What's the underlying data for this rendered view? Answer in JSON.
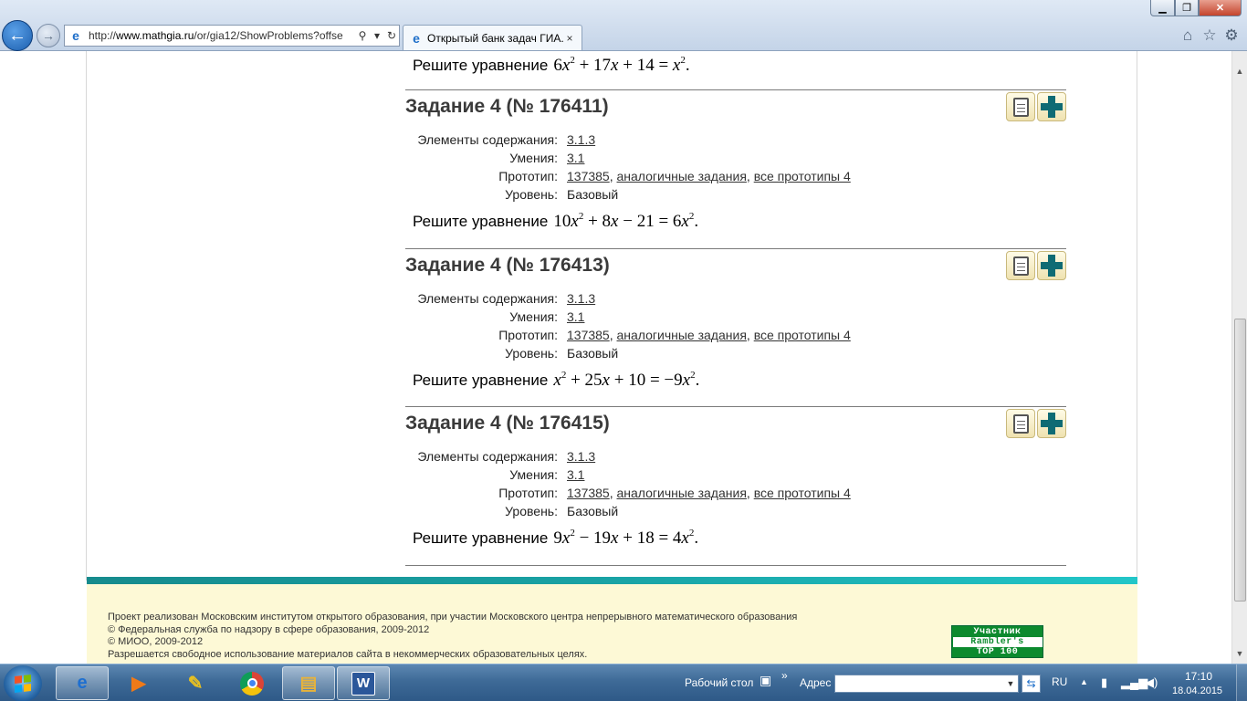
{
  "browser": {
    "address_url_prefix": "http://",
    "address_url_domain": "www.mathgia.ru",
    "address_url_path": "/or/gia12/ShowProblems?offse",
    "tab_title": "Открытый банк задач ГИА...",
    "tab_close": "×",
    "back_glyph": "←",
    "forward_glyph": "→",
    "search_glyph": "⚲",
    "dropdown_glyph": "▾",
    "refresh_glyph": "↻",
    "minimize_glyph": "▁",
    "maximize_glyph": "❐",
    "close_glyph": "✕",
    "home_glyph": "⌂",
    "favorites_glyph": "☆",
    "tools_glyph": "⚙"
  },
  "page": {
    "partial_prompt": "Решите уравнение",
    "tasks": [
      {
        "title": "Задание 4 (№ 176411)",
        "labels": {
          "content": "Элементы содержания:",
          "skills": "Умения:",
          "prototype": "Прототип:",
          "level": "Уровень:"
        },
        "content_code": "3.1.3",
        "skill_code": "3.1",
        "prototype_id": "137385",
        "similar_link": "аналогичные задания",
        "all_prototypes_link": "все прототипы 4",
        "level": "Базовый",
        "prompt": "Решите уравнение"
      },
      {
        "title": "Задание 4 (№ 176413)",
        "labels": {
          "content": "Элементы содержания:",
          "skills": "Умения:",
          "prototype": "Прототип:",
          "level": "Уровень:"
        },
        "content_code": "3.1.3",
        "skill_code": "3.1",
        "prototype_id": "137385",
        "similar_link": "аналогичные задания",
        "all_prototypes_link": "все прототипы 4",
        "level": "Базовый",
        "prompt": "Решите уравнение"
      },
      {
        "title": "Задание 4 (№ 176415)",
        "labels": {
          "content": "Элементы содержания:",
          "skills": "Умения:",
          "prototype": "Прототип:",
          "level": "Уровень:"
        },
        "content_code": "3.1.3",
        "skill_code": "3.1",
        "prototype_id": "137385",
        "similar_link": "аналогичные задания",
        "all_prototypes_link": "все прототипы 4",
        "level": "Базовый",
        "prompt": "Решите уравнение"
      }
    ],
    "footer": {
      "line1": "Проект реализован Московским институтом открытого образования, при участии Московского центра непрерывного математического образования",
      "line2": "© Федеральная служба по надзору в сфере образования, 2009-2012",
      "line3": "© МИОО, 2009-2012",
      "line4": "Разрешается свободное использование материалов сайта в некоммерческих образовательных целях.",
      "rambler_top": "Участник",
      "rambler_mid": "Rambler's",
      "rambler_bottom": "TOP 100"
    }
  },
  "taskbar": {
    "desktop_label": "Рабочий стол",
    "more_glyph": "»",
    "address_label": "Адрес",
    "address_value": "",
    "lang": "RU",
    "time": "17:10",
    "date": "18.04.2015",
    "word_letter": "W",
    "ie_letter": "e"
  },
  "colors": {
    "accent_teal": "#19a3a5",
    "footer_bg": "#fdf9d6",
    "plus_icon": "#0f6b74",
    "taskbar": "#3e6a97"
  }
}
